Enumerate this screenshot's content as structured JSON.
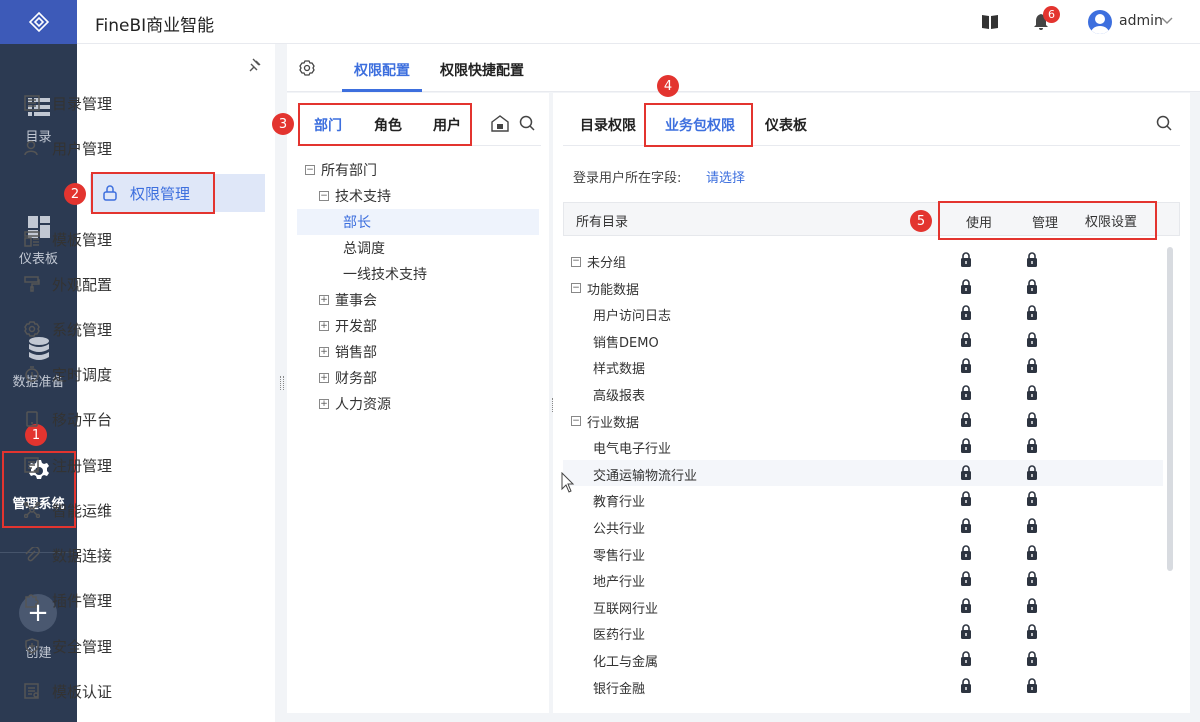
{
  "app": {
    "title": "FineBI商业智能",
    "user": "admin",
    "notifications": "6"
  },
  "rail": {
    "items": [
      {
        "label": "目录"
      },
      {
        "label": "仪表板"
      },
      {
        "label": "数据准备"
      },
      {
        "label": "管理系统"
      },
      {
        "label": "创建"
      }
    ]
  },
  "sidebar": {
    "items": [
      {
        "label": "目录管理"
      },
      {
        "label": "用户管理"
      },
      {
        "label": "权限管理"
      },
      {
        "label": "模板管理"
      },
      {
        "label": "外观配置"
      },
      {
        "label": "系统管理"
      },
      {
        "label": "定时调度"
      },
      {
        "label": "移动平台"
      },
      {
        "label": "注册管理"
      },
      {
        "label": "智能运维"
      },
      {
        "label": "数据连接"
      },
      {
        "label": "插件管理"
      },
      {
        "label": "安全管理"
      },
      {
        "label": "模板认证"
      }
    ]
  },
  "main_tabs": [
    "权限配置",
    "权限快捷配置"
  ],
  "left_tabs": [
    "部门",
    "角色",
    "用户"
  ],
  "dept_tree": {
    "root": "所有部门",
    "group": "技术支持",
    "children": [
      "部长",
      "总调度",
      "一线技术支持"
    ],
    "others": [
      "董事会",
      "开发部",
      "销售部",
      "财务部",
      "人力资源"
    ]
  },
  "right_tabs": [
    "目录权限",
    "业务包权限",
    "仪表板"
  ],
  "field_label": "登录用户所在字段:",
  "field_action": "请选择",
  "table_header": {
    "catalog": "所有目录",
    "use": "使用",
    "manage": "管理",
    "setting": "权限设置"
  },
  "rows": [
    {
      "name": "未分组",
      "level": 0,
      "exp": "−"
    },
    {
      "name": "功能数据",
      "level": 0,
      "exp": "−"
    },
    {
      "name": "用户访问日志",
      "level": 1
    },
    {
      "name": "销售DEMO",
      "level": 1
    },
    {
      "name": "样式数据",
      "level": 1
    },
    {
      "name": "高级报表",
      "level": 1
    },
    {
      "name": "行业数据",
      "level": 0,
      "exp": "−"
    },
    {
      "name": "电气电子行业",
      "level": 1
    },
    {
      "name": "交通运输物流行业",
      "level": 1
    },
    {
      "name": "教育行业",
      "level": 1
    },
    {
      "name": "公共行业",
      "level": 1
    },
    {
      "name": "零售行业",
      "level": 1
    },
    {
      "name": "地产行业",
      "level": 1
    },
    {
      "name": "互联网行业",
      "level": 1
    },
    {
      "name": "医药行业",
      "level": 1
    },
    {
      "name": "化工与金属",
      "level": 1
    },
    {
      "name": "银行金融",
      "level": 1
    }
  ],
  "callouts": [
    "1",
    "2",
    "3",
    "4",
    "5"
  ]
}
